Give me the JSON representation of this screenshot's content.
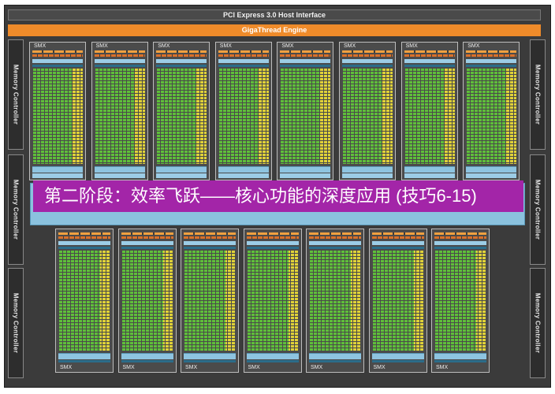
{
  "chip": {
    "pcie_label": "PCI Express 3.0 Host Interface",
    "gigathread_label": "GigaThread Engine",
    "memory_controller_label": "Memory Controller",
    "smx_label": "SMX",
    "top_smx_count": 8,
    "bottom_smx_count": 7
  },
  "banner": {
    "text": "第二阶段：效率飞跃——核心功能的深度应用 (技巧6-15)"
  },
  "colors": {
    "die": "#3b3b3b",
    "gigathread": "#ef8b2a",
    "cuda_core": "#5fbf3a",
    "special_unit": "#e0d238",
    "cache": "#8bc2de",
    "banner": "#a325a8"
  }
}
